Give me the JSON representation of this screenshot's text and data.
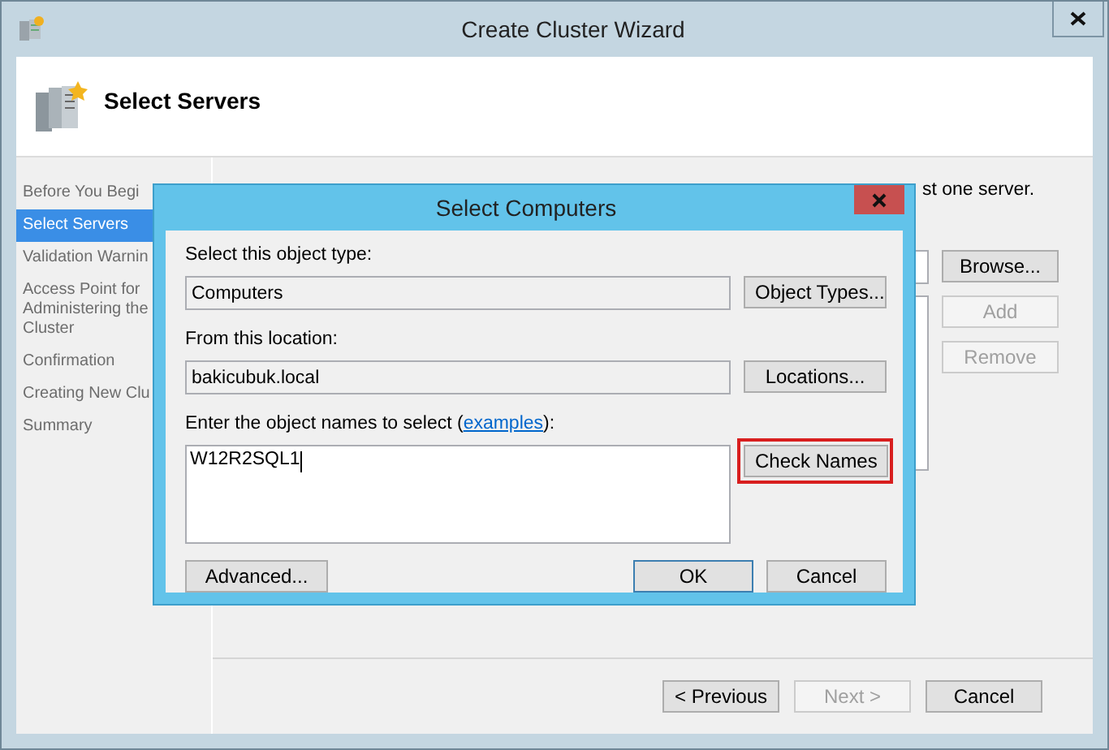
{
  "window": {
    "title": "Create Cluster Wizard"
  },
  "header": {
    "title": "Select Servers"
  },
  "steps": [
    {
      "label": "Before You Begi",
      "selected": false
    },
    {
      "label": "Select Servers",
      "selected": true
    },
    {
      "label": "Validation Warnin",
      "selected": false
    },
    {
      "label": "Access Point for Administering the Cluster",
      "selected": false
    },
    {
      "label": "Confirmation",
      "selected": false
    },
    {
      "label": "Creating New Clu",
      "selected": false
    },
    {
      "label": "Summary",
      "selected": false
    }
  ],
  "intro": "st one server.",
  "side_buttons": [
    {
      "label": "Browse...",
      "disabled": false
    },
    {
      "label": "Add",
      "disabled": true
    },
    {
      "label": "Remove",
      "disabled": true
    }
  ],
  "nav_buttons": [
    {
      "label": "< Previous",
      "disabled": false
    },
    {
      "label": "Next >",
      "disabled": true
    },
    {
      "label": "Cancel",
      "disabled": false
    }
  ],
  "dialog": {
    "title": "Select Computers",
    "object_type_label": "Select this object type:",
    "object_type": "Computers",
    "object_types_button": "Object Types...",
    "location_label": "From this location:",
    "location": "bakicubuk.local",
    "locations_button": "Locations...",
    "names_label_start": "Enter the object names to select (",
    "names_link": "examples",
    "names_label_end": "):",
    "names": "W12R2SQL1",
    "check_names_button": {
      "label": "Check Names",
      "highlighted": true
    },
    "buttons": [
      {
        "label": "Advanced...",
        "default": false
      },
      {
        "label": "OK",
        "default": true
      },
      {
        "label": "Cancel",
        "default": false
      }
    ]
  }
}
